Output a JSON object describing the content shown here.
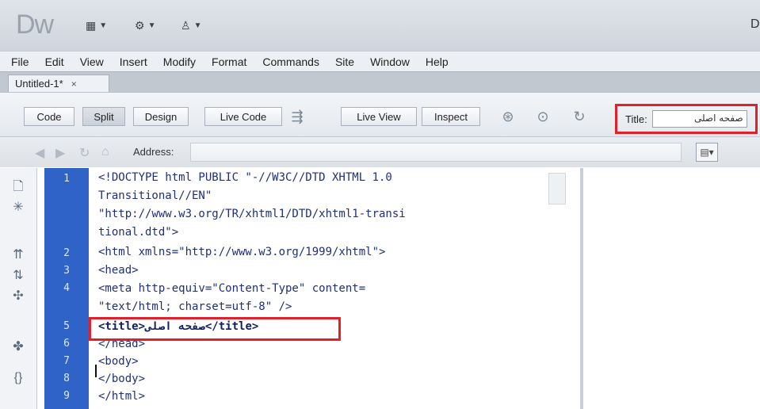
{
  "app": {
    "logo": "Dw"
  },
  "titlebar": {
    "buttons": [
      {
        "icon": "layout-icon",
        "glyph": "▦"
      },
      {
        "icon": "gear-icon",
        "glyph": "⚙"
      },
      {
        "icon": "user-icon",
        "glyph": "♙"
      }
    ],
    "edge_text": "D"
  },
  "menu": [
    "File",
    "Edit",
    "View",
    "Insert",
    "Modify",
    "Format",
    "Commands",
    "Site",
    "Window",
    "Help"
  ],
  "document_tab": {
    "label": "Untitled-1*",
    "close": "×"
  },
  "toolbar": {
    "code_label": "Code",
    "split_label": "Split",
    "design_label": "Design",
    "live_code_label": "Live Code",
    "live_view_label": "Live View",
    "inspect_label": "Inspect",
    "title_label": "Title:",
    "title_value": "صفحه اصلی"
  },
  "address": {
    "label": "Address:",
    "value": ""
  },
  "code": {
    "line_numbers": [
      "1",
      "2",
      "3",
      "4",
      "5",
      "6",
      "7",
      "8",
      "9"
    ],
    "lines": [
      "<!DOCTYPE html PUBLIC \"-//W3C//DTD XHTML 1.0",
      "Transitional//EN\"",
      "\"http://www.w3.org/TR/xhtml1/DTD/xhtml1-transi",
      "tional.dtd\">",
      "<html xmlns=\"http://www.w3.org/1999/xhtml\">",
      "<head>",
      "<meta http-equiv=\"Content-Type\" content=",
      "\"text/html; charset=utf-8\" />",
      "<title>صفحه اصلی</title>",
      "</head>",
      "<body>",
      "</body>",
      "</html>"
    ]
  },
  "colors": {
    "gutter": "#2f63c7",
    "code_text": "#1f2f7a",
    "highlight_box": "#e0202a"
  }
}
